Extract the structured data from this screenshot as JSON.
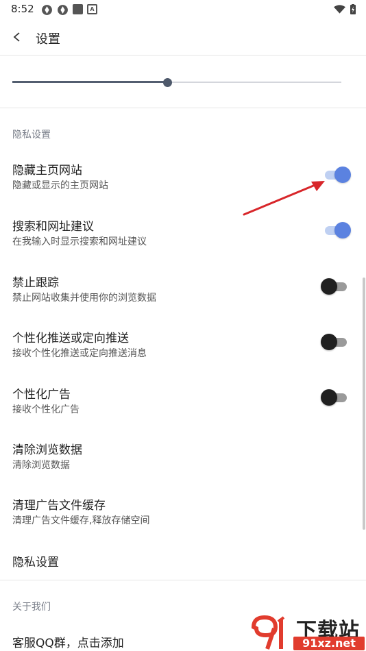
{
  "status_bar": {
    "time": "8:52",
    "notif_icon_text": "A"
  },
  "app_bar": {
    "title": "设置"
  },
  "slider": {
    "value_fraction": 0.47
  },
  "sections": {
    "privacy_header": "隐私设置",
    "about_header": "关于我们"
  },
  "rows": [
    {
      "title": "隐藏主页网站",
      "subtitle": "隐藏或显示的主页网站",
      "toggle": true
    },
    {
      "title": "搜索和网址建议",
      "subtitle": "在我输入时显示搜索和网址建议",
      "toggle": true
    },
    {
      "title": "禁止跟踪",
      "subtitle": "禁止网站收集并使用你的浏览数据",
      "toggle": false
    },
    {
      "title": "个性化推送或定向推送",
      "subtitle": "接收个性化推送或定向推送消息",
      "toggle": false
    },
    {
      "title": "个性化广告",
      "subtitle": "接收个性化广告",
      "toggle": false
    },
    {
      "title": "清除浏览数据",
      "subtitle": "清除浏览数据"
    },
    {
      "title": "清理广告文件缓存",
      "subtitle": "清理广告文件缓存,释放存储空间"
    },
    {
      "title": "隐私设置"
    },
    {
      "title": "客服QQ群，点击添加"
    }
  ],
  "watermark": {
    "top": "下载站",
    "bottom": "91xz.net"
  },
  "colors": {
    "accent": "#5b82e0",
    "accent_track": "#bfd0f2",
    "annotation_arrow": "#d8262a"
  }
}
